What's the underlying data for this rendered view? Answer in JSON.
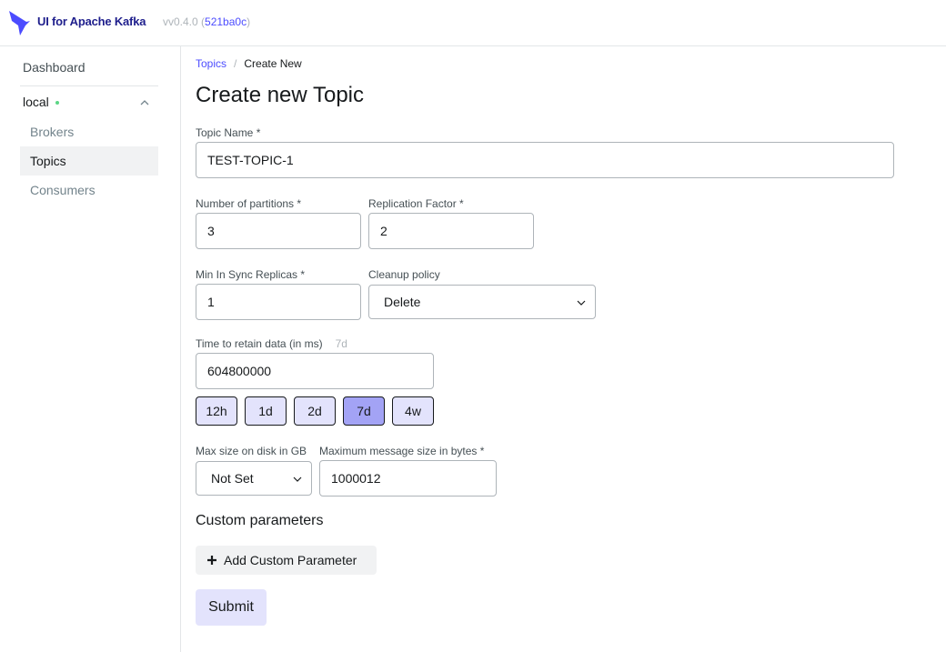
{
  "header": {
    "app_title": "UI for Apache Kafka",
    "version_prefix": "vv0.4.0 (",
    "commit": "521ba0c",
    "version_suffix": ")"
  },
  "sidebar": {
    "dashboard": "Dashboard",
    "cluster": {
      "name": "local",
      "status": "online",
      "status_color": "#5cd685"
    },
    "items": [
      {
        "label": "Brokers",
        "active": false
      },
      {
        "label": "Topics",
        "active": true
      },
      {
        "label": "Consumers",
        "active": false
      }
    ]
  },
  "breadcrumb": {
    "parent": "Topics",
    "separator": "/",
    "current": "Create New"
  },
  "page_title": "Create new Topic",
  "form": {
    "topic_name": {
      "label": "Topic Name *",
      "value": "TEST-TOPIC-1"
    },
    "partitions": {
      "label": "Number of partitions *",
      "value": "3"
    },
    "replication": {
      "label": "Replication Factor *",
      "value": "2"
    },
    "min_isr": {
      "label": "Min In Sync Replicas *",
      "value": "1"
    },
    "cleanup": {
      "label": "Cleanup policy",
      "value": "Delete"
    },
    "retention": {
      "label": "Time to retain data (in ms)",
      "hint": "7d",
      "value": "604800000",
      "presets": [
        {
          "label": "12h",
          "selected": false
        },
        {
          "label": "1d",
          "selected": false
        },
        {
          "label": "2d",
          "selected": false
        },
        {
          "label": "7d",
          "selected": true
        },
        {
          "label": "4w",
          "selected": false
        }
      ]
    },
    "max_disk": {
      "label": "Max size on disk in GB",
      "value": "Not Set"
    },
    "max_message": {
      "label": "Maximum message size in bytes *",
      "value": "1000012"
    },
    "custom_params_title": "Custom parameters",
    "add_custom_label": "Add Custom Parameter",
    "submit_label": "Submit"
  },
  "colors": {
    "accent": "#4c4cff",
    "brand": "#1e1e8c",
    "preset_bg": "#e3e3fc",
    "preset_selected_bg": "#a3a3f5"
  }
}
